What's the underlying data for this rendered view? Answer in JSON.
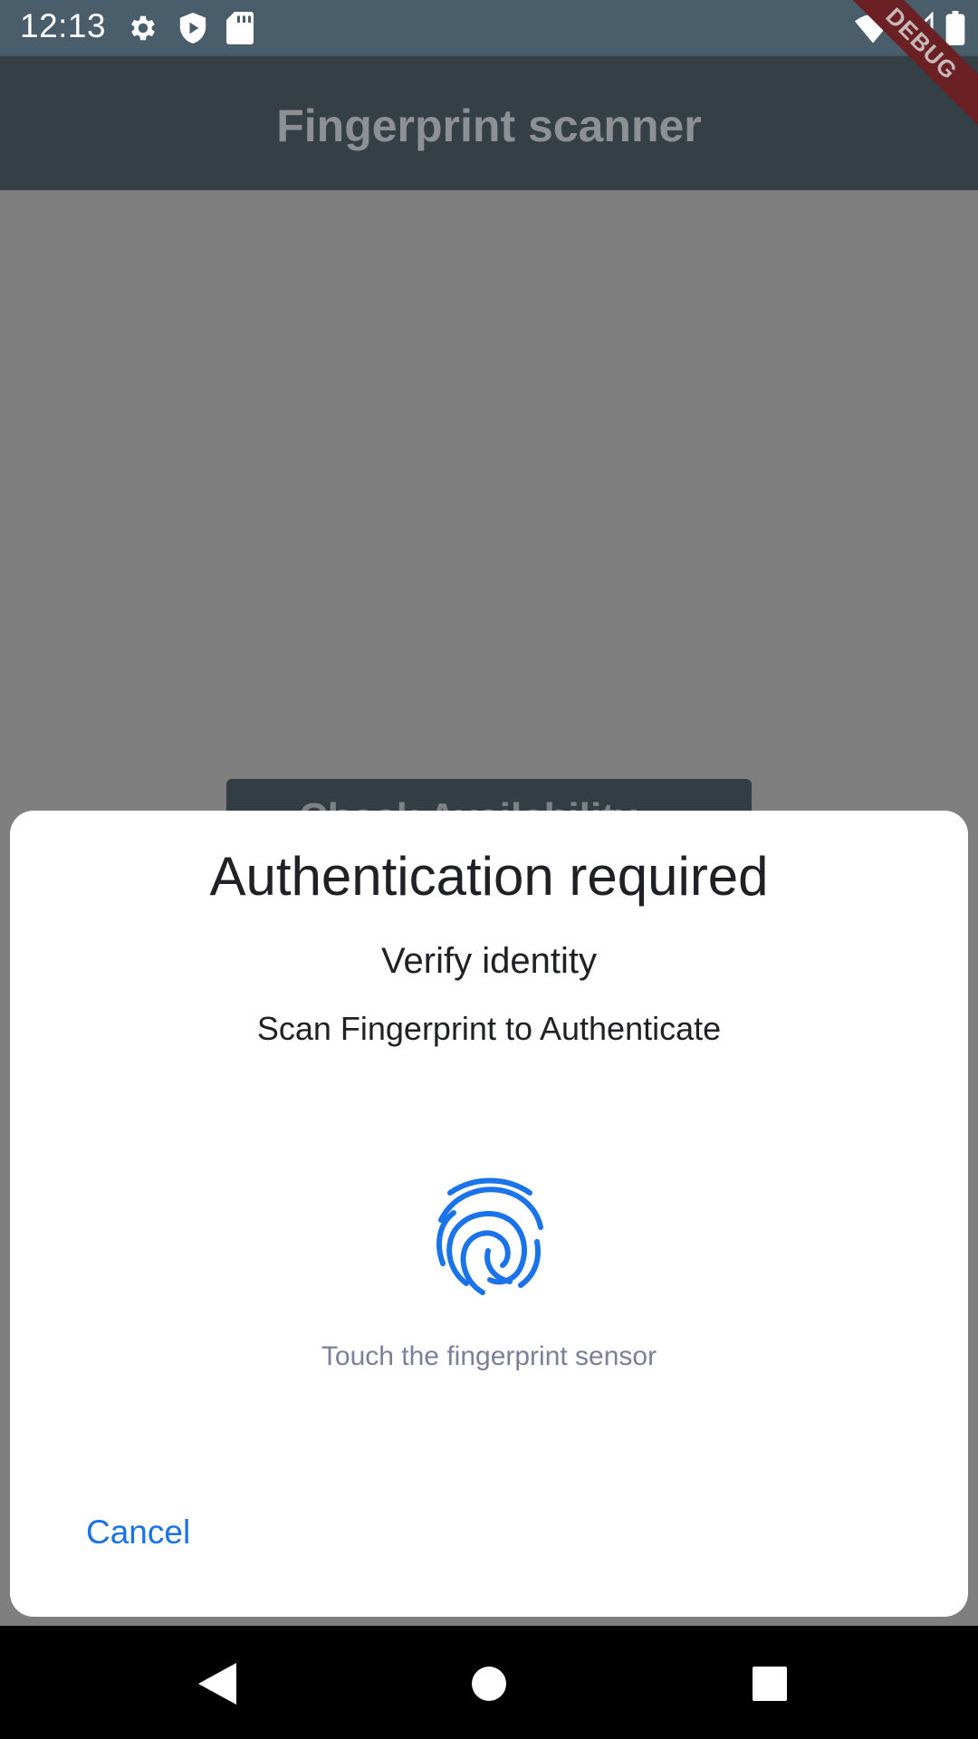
{
  "status_bar": {
    "time": "12:13",
    "left_icons": [
      "gear-icon",
      "shield-play-icon",
      "sd-card-icon"
    ],
    "right_icons": [
      "wifi-icon",
      "cell-signal-icon",
      "battery-icon"
    ]
  },
  "app_bar": {
    "title": "Fingerprint scanner",
    "debug_label": "DEBUG"
  },
  "main": {
    "check_button_label": "Check Availability"
  },
  "dialog": {
    "title": "Authentication required",
    "subtitle": "Verify identity",
    "description": "Scan Fingerprint to Authenticate",
    "hint": "Touch the fingerprint sensor",
    "cancel_label": "Cancel",
    "icon": "fingerprint-icon"
  },
  "nav_bar": {
    "buttons": [
      "back-icon",
      "home-icon",
      "recents-icon"
    ]
  },
  "colors": {
    "accent": "#1a73e8",
    "scrim": "#7f7f7f",
    "app_bar": "#343f46",
    "status_bar": "#4a5d6a"
  }
}
